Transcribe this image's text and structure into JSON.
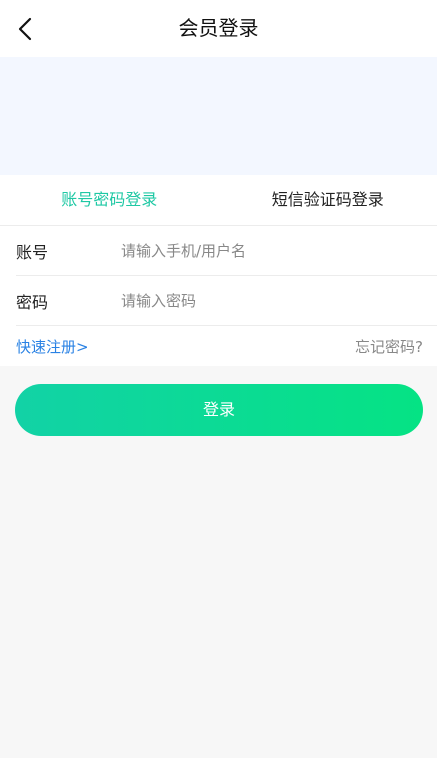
{
  "header": {
    "title": "会员登录",
    "back_icon": "chevron-left-icon"
  },
  "tabs": [
    {
      "label": "账号密码登录",
      "active": true
    },
    {
      "label": "短信验证码登录",
      "active": false
    }
  ],
  "form": {
    "account": {
      "label": "账号",
      "placeholder": "请输入手机/用户名",
      "value": ""
    },
    "password": {
      "label": "密码",
      "placeholder": "请输入密码",
      "value": ""
    }
  },
  "links": {
    "register": "快速注册>",
    "forgot": "忘记密码?"
  },
  "login_button": "登录",
  "colors": {
    "accent": "#1ec8a4",
    "link": "#2a82e4",
    "button_gradient_start": "#12d2a6",
    "button_gradient_end": "#05e384",
    "banner_bg": "#f3f7ff",
    "page_bg": "#f7f7f7"
  }
}
